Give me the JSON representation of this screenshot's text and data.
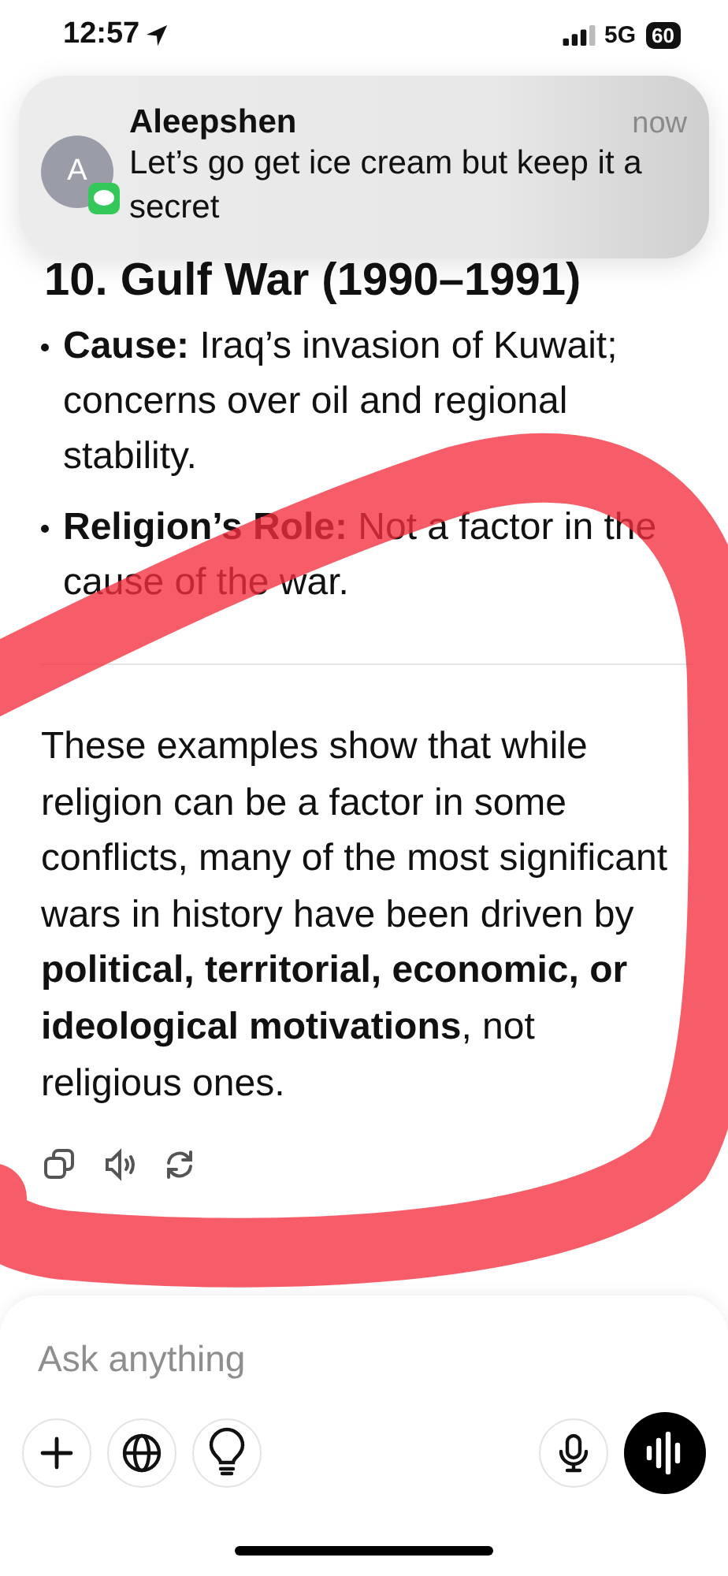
{
  "status_bar": {
    "time": "12:57",
    "network": "5G",
    "battery": "60"
  },
  "notification": {
    "avatar_letter": "A",
    "sender": "Aleepshen",
    "time": "now",
    "message": "Let’s go get ice cream but keep it a secret"
  },
  "answer": {
    "heading": "10. Gulf War (1990–1991)",
    "bullets": [
      {
        "text": "**Cause:** Iraq’s invasion of Kuwait; concerns over oil and regional stability."
      },
      {
        "text": "**Religion’s Role:** Not a factor in the cause of the war."
      }
    ],
    "paragraph": "These examples show that while religion can be a factor in some conflicts, many of the most significant wars in history have been driven by **political, territorial, economic, or ideological motivations**, not religious ones."
  },
  "composer": {
    "placeholder": "Ask anything"
  }
}
